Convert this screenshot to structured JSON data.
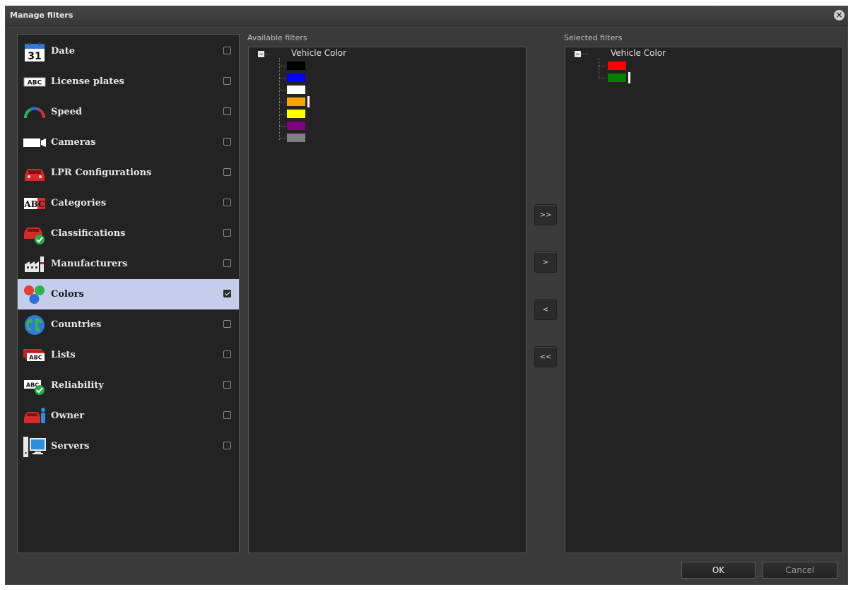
{
  "dialog": {
    "title": "Manage filters"
  },
  "categories": [
    {
      "label": "Date",
      "icon": "calendar-icon",
      "icon_text": "31",
      "checked": false
    },
    {
      "label": "License plates",
      "icon": "license-plate-icon",
      "icon_text": "ABC",
      "checked": false
    },
    {
      "label": "Speed",
      "icon": "speedometer-icon",
      "checked": false
    },
    {
      "label": "Cameras",
      "icon": "camera-icon",
      "checked": false
    },
    {
      "label": "LPR Configurations",
      "icon": "car-icon",
      "checked": false
    },
    {
      "label": "Categories",
      "icon": "categories-icon",
      "icon_text": "ABC",
      "checked": false
    },
    {
      "label": "Classifications",
      "icon": "car-check-icon",
      "checked": false
    },
    {
      "label": "Manufacturers",
      "icon": "factory-icon",
      "checked": false
    },
    {
      "label": "Colors",
      "icon": "colors-icon",
      "checked": true
    },
    {
      "label": "Countries",
      "icon": "globe-icon",
      "checked": false
    },
    {
      "label": "Lists",
      "icon": "lists-icon",
      "icon_text": "ABC",
      "checked": false
    },
    {
      "label": "Reliability",
      "icon": "reliability-icon",
      "icon_text": "ABC",
      "checked": false
    },
    {
      "label": "Owner",
      "icon": "owner-icon",
      "checked": false
    },
    {
      "label": "Servers",
      "icon": "server-icon",
      "checked": false
    }
  ],
  "available": {
    "header": "Available filters",
    "group_label": "Vehicle Color",
    "swatches": [
      "#000000",
      "#0000ff",
      "#ffffff",
      "#ffa500",
      "#ffff00",
      "#800080",
      "#808080"
    ]
  },
  "selected": {
    "header": "Selected filters",
    "group_label": "Vehicle Color",
    "swatches": [
      "#ff0000",
      "#008000"
    ]
  },
  "move_buttons": {
    "add_all": ">>",
    "add": ">",
    "remove": "<",
    "remove_all": "<<"
  },
  "buttons": {
    "ok": "OK",
    "cancel": "Cancel"
  },
  "colors": {
    "selected_row": "#c4cde9",
    "panel_bg": "#232323",
    "dialog_bg": "#3a3a3a"
  }
}
